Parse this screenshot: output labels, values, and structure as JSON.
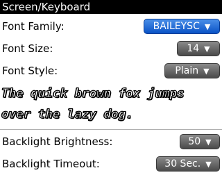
{
  "title": "Screen/Keyboard",
  "settings": {
    "font_family": {
      "label": "Font Family:",
      "value": "BAILEYSC"
    },
    "font_size": {
      "label": "Font Size:",
      "value": "14"
    },
    "font_style": {
      "label": "Font Style:",
      "value": "Plain"
    },
    "backlight_brightness": {
      "label": "Backlight Brightness:",
      "value": "50"
    },
    "backlight_timeout": {
      "label": "Backlight Timeout:",
      "value": "30 Sec."
    }
  },
  "preview": {
    "line1": "The quick brown fox jumps",
    "line2": "over the lazy dog."
  },
  "icons": {
    "dropdown_arrow": "triangle-down"
  },
  "colors": {
    "titlebar": "#000000",
    "selected_dropdown": "#1a62d6",
    "dropdown": "#5a5a5a"
  }
}
